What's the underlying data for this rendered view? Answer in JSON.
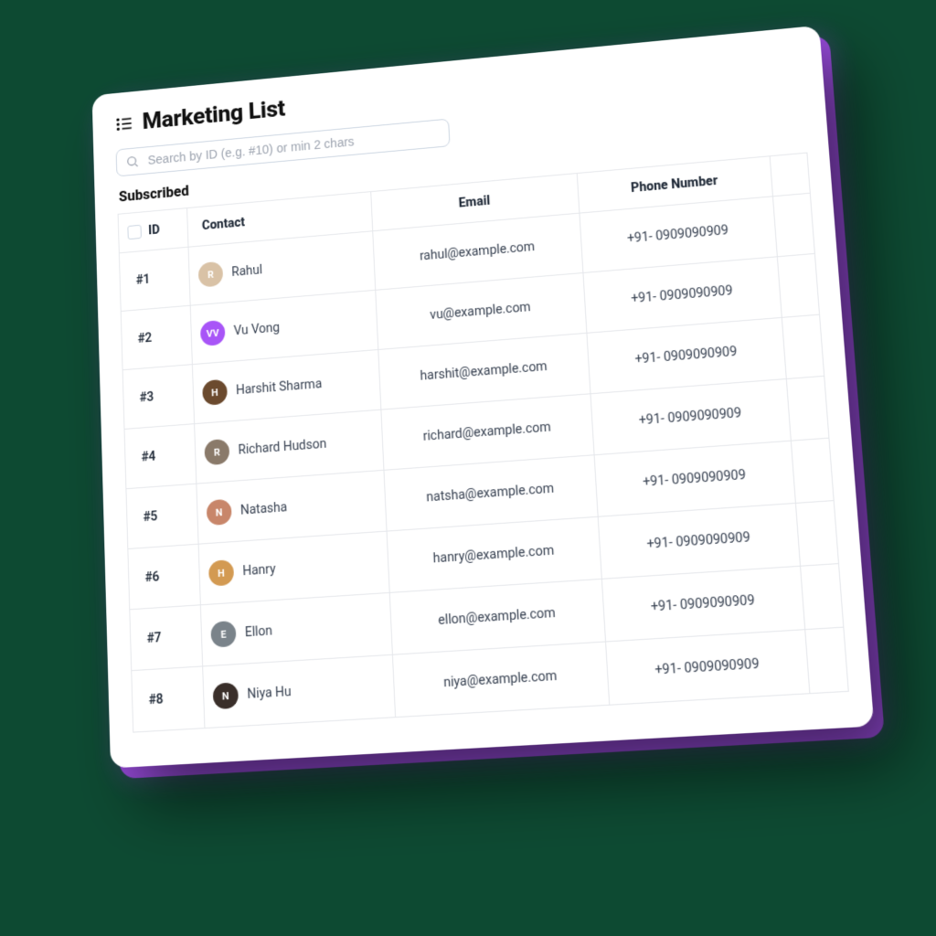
{
  "header": {
    "title": "Marketing List"
  },
  "search": {
    "placeholder": "Search by ID (e.g. #10) or min 2 chars"
  },
  "section": {
    "label": "Subscribed"
  },
  "table": {
    "columns": {
      "id": "ID",
      "contact": "Contact",
      "email": "Email",
      "phone": "Phone Number"
    },
    "rows": [
      {
        "id": "#1",
        "name": "Rahul",
        "initials": "R",
        "avatar_bg": "#d9c2a6",
        "email": "rahul@example.com",
        "phone": "+91- 0909090909"
      },
      {
        "id": "#2",
        "name": "Vu Vong",
        "initials": "VV",
        "avatar_bg": "#a855f7",
        "email": "vu@example.com",
        "phone": "+91- 0909090909"
      },
      {
        "id": "#3",
        "name": "Harshit Sharma",
        "initials": "H",
        "avatar_bg": "#6b4a2e",
        "email": "harshit@example.com",
        "phone": "+91- 0909090909"
      },
      {
        "id": "#4",
        "name": "Richard Hudson",
        "initials": "R",
        "avatar_bg": "#8a7a6a",
        "email": "richard@example.com",
        "phone": "+91- 0909090909"
      },
      {
        "id": "#5",
        "name": "Natasha",
        "initials": "N",
        "avatar_bg": "#c8866a",
        "email": "natsha@example.com",
        "phone": "+91- 0909090909"
      },
      {
        "id": "#6",
        "name": "Hanry",
        "initials": "H",
        "avatar_bg": "#d39a52",
        "email": "hanry@example.com",
        "phone": "+91- 0909090909"
      },
      {
        "id": "#7",
        "name": "Ellon",
        "initials": "E",
        "avatar_bg": "#7a838a",
        "email": "ellon@example.com",
        "phone": "+91- 0909090909"
      },
      {
        "id": "#8",
        "name": "Niya Hu",
        "initials": "N",
        "avatar_bg": "#3a2f2a",
        "email": "niya@example.com",
        "phone": "+91- 0909090909"
      }
    ]
  }
}
